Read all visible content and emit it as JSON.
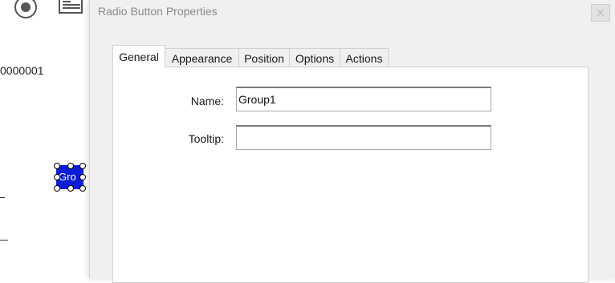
{
  "background": {
    "field_id_text": "0000001",
    "selected_field_text": "Gro"
  },
  "dialog": {
    "title": "Radio Button Properties",
    "close_label": "✕",
    "tabs": [
      {
        "label": "General"
      },
      {
        "label": "Appearance"
      },
      {
        "label": "Position"
      },
      {
        "label": "Options"
      },
      {
        "label": "Actions"
      }
    ],
    "active_tab": "General",
    "fields": {
      "name": {
        "label": "Name:",
        "value": "Group1"
      },
      "tooltip": {
        "label": "Tooltip:",
        "value": ""
      }
    }
  }
}
